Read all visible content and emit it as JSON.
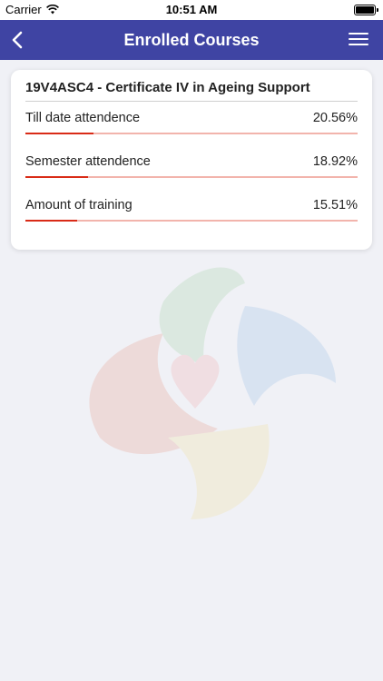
{
  "status_bar": {
    "carrier": "Carrier",
    "time": "10:51 AM"
  },
  "nav": {
    "title": "Enrolled Courses"
  },
  "course": {
    "title": "19V4ASC4 - Certificate IV in Ageing Support",
    "stats": [
      {
        "label": "Till date attendence",
        "value": "20.56%",
        "fraction": 0.2056
      },
      {
        "label": "Semester attendence",
        "value": "18.92%",
        "fraction": 0.1892
      },
      {
        "label": "Amount of training",
        "value": "15.51%",
        "fraction": 0.1551
      }
    ]
  },
  "colors": {
    "nav_background": "#3f44a3",
    "progress_fill": "#d92b17",
    "progress_track": "#f2b4ac"
  }
}
